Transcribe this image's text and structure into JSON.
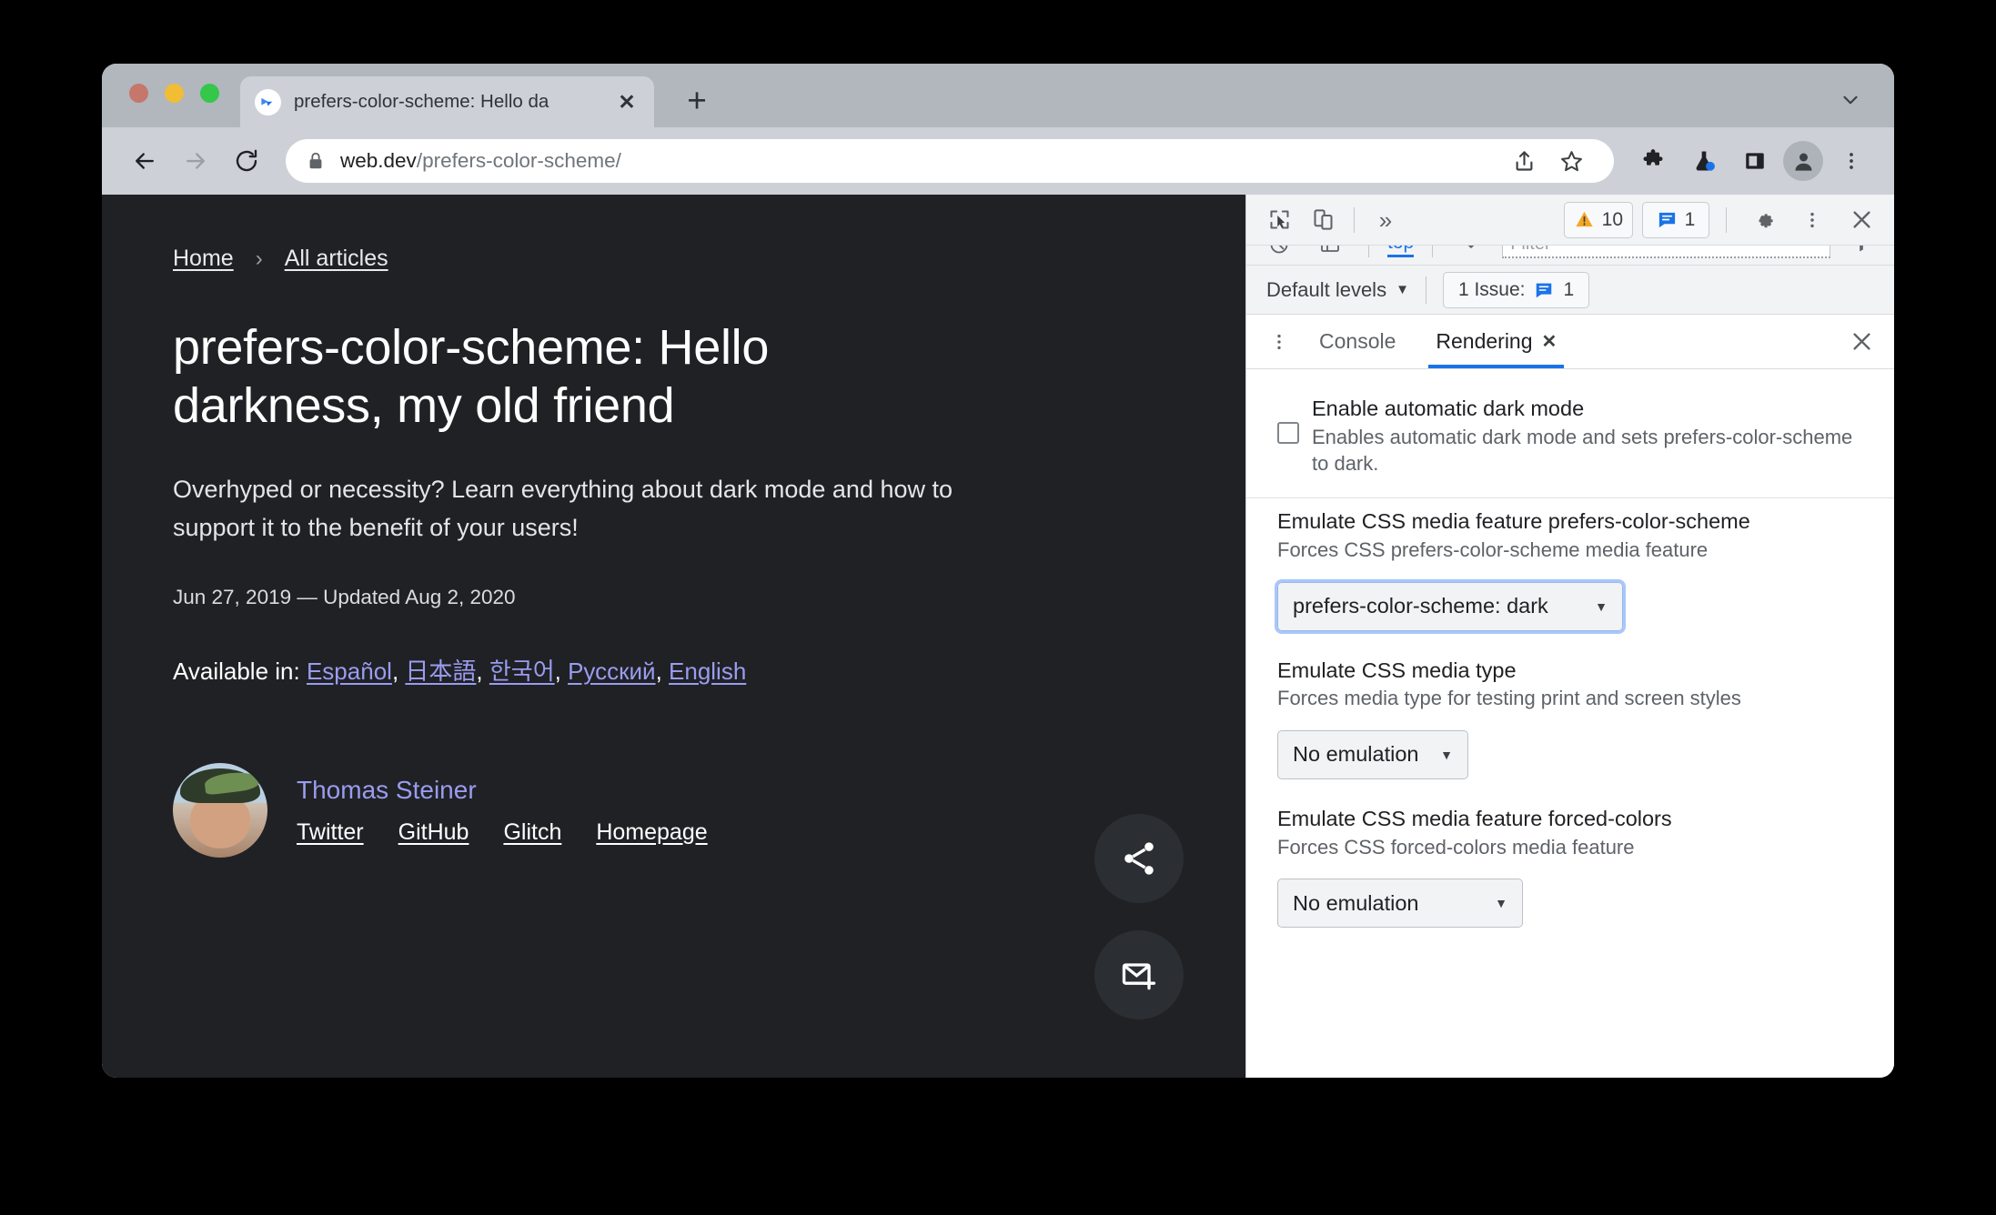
{
  "browser": {
    "tab": {
      "title": "prefers-color-scheme: Hello da",
      "close_label": "✕"
    },
    "new_tab_label": "+",
    "omnibox": {
      "url_domain": "web.dev",
      "url_path": "/prefers-color-scheme/"
    },
    "icons": {
      "back": "back-arrow-icon",
      "forward": "forward-arrow-icon",
      "reload": "reload-icon",
      "lock": "lock-icon",
      "share": "share-icon",
      "bookmark": "star-icon",
      "extensions": "puzzle-icon",
      "experiments": "flask-icon",
      "side_panel": "side-panel-icon",
      "profile": "avatar-icon",
      "menu": "three-dot-menu-icon",
      "tabstrip_chevron": "chevron-down-icon"
    }
  },
  "page": {
    "breadcrumb": {
      "home": "Home",
      "separator": "›",
      "all_articles": "All articles"
    },
    "headline": "prefers-color-scheme: Hello darkness, my old friend",
    "lede": "Overhyped or necessity? Learn everything about dark mode and how to support it to the benefit of your users!",
    "dateline": "Jun 27, 2019 — Updated Aug 2, 2020",
    "available_label": "Available in:",
    "languages": [
      "Español",
      "日本語",
      "한국어",
      "Русский",
      "English"
    ],
    "author": {
      "name": "Thomas Steiner",
      "links": [
        "Twitter",
        "GitHub",
        "Glitch",
        "Homepage"
      ]
    },
    "fabs": [
      {
        "name": "share-fab",
        "icon": "share-icon"
      },
      {
        "name": "subscribe-fab",
        "icon": "envelope-plus-icon"
      }
    ]
  },
  "devtools": {
    "main_toolbar": {
      "inspect_icon": "inspect-cursor-icon",
      "device_icon": "device-toolbar-icon",
      "overflow_label": "»",
      "warnings_count": "10",
      "issues_count": "1",
      "settings_icon": "gear-icon",
      "menu_icon": "three-dot-menu-icon",
      "close_icon": "close-icon"
    },
    "console_toolbar": {
      "context": "top",
      "filter_placeholder": "Filter"
    },
    "levels_bar": {
      "levels_label": "Default levels",
      "caret": "▼",
      "issues_label": "1 Issue:",
      "issues_value": "1"
    },
    "drawer_tabs": [
      {
        "label": "Console",
        "active": false
      },
      {
        "label": "Rendering",
        "active": true,
        "closable": "✕"
      }
    ],
    "drawer_close": "✕",
    "rendering": {
      "settings": [
        {
          "title": "Enable automatic dark mode",
          "desc": "Enables automatic dark mode and sets prefers-color-scheme to dark.",
          "control": "checkbox",
          "checked": false
        },
        {
          "title": "Emulate CSS media feature prefers-color-scheme",
          "desc": "Forces CSS prefers-color-scheme media feature",
          "control": "select",
          "value": "prefers-color-scheme: dark",
          "focused": true
        },
        {
          "title": "Emulate CSS media type",
          "desc": "Forces media type for testing print and screen styles",
          "control": "select",
          "value": "No emulation",
          "focused": false
        },
        {
          "title": "Emulate CSS media feature forced-colors",
          "desc": "Forces CSS forced-colors media feature",
          "control": "select",
          "value": "No emulation",
          "focused": false
        }
      ]
    }
  },
  "colors": {
    "page_bg": "#202124",
    "accent_link": "#9a9cf0",
    "devtools_accent": "#1a73e8",
    "warning": "#f5a623",
    "focus_ring": "#a8c7fa"
  }
}
